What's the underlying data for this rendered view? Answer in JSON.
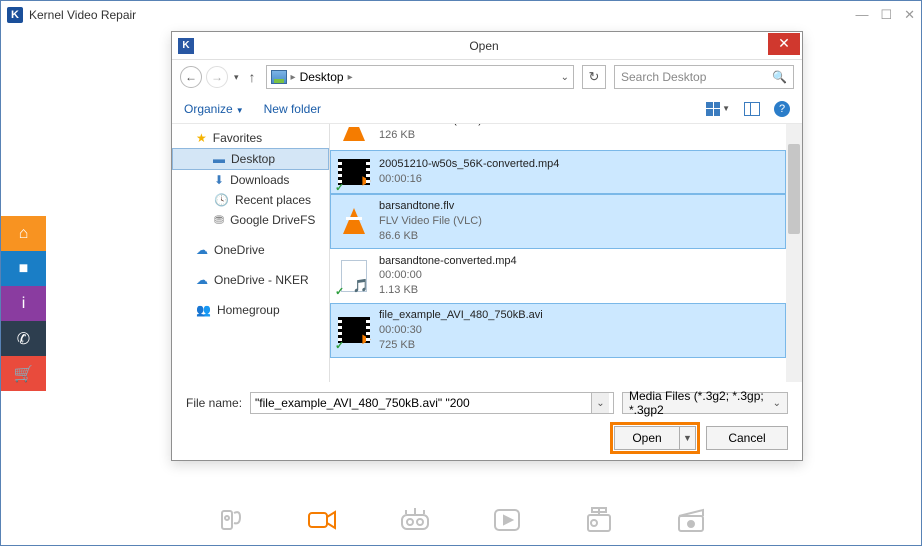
{
  "app": {
    "title": "Kernel Video Repair",
    "icon_letter": "K"
  },
  "dialog": {
    "title": "Open",
    "icon_letter": "K",
    "breadcrumb": {
      "location": "Desktop"
    },
    "search_placeholder": "Search Desktop",
    "organize_label": "Organize",
    "newfolder_label": "New folder",
    "nav": {
      "favorites": "Favorites",
      "desktop": "Desktop",
      "downloads": "Downloads",
      "recent": "Recent places",
      "gdrive": "Google DriveFS",
      "onedrive": "OneDrive",
      "onedrive_nker": "OneDrive - NKER",
      "homegroup": "Homegroup"
    },
    "files": [
      {
        "name": "FLV Video File (VLC)",
        "meta1": "126 KB",
        "meta2": "",
        "thumb": "vlc",
        "selected": false,
        "partial": true
      },
      {
        "name": "20051210-w50s_56K-converted.mp4",
        "meta1": "00:00:16",
        "meta2": "",
        "thumb": "video",
        "selected": true
      },
      {
        "name": "barsandtone.flv",
        "meta1": "FLV Video File (VLC)",
        "meta2": "86.6 KB",
        "thumb": "vlc",
        "selected": true
      },
      {
        "name": "barsandtone-converted.mp4",
        "meta1": "00:00:00",
        "meta2": "1.13 KB",
        "thumb": "doc",
        "selected": false
      },
      {
        "name": "file_example_AVI_480_750kB.avi",
        "meta1": "00:00:30",
        "meta2": "725 KB",
        "thumb": "video",
        "selected": true
      }
    ],
    "filename_label": "File name:",
    "filename_value": "\"file_example_AVI_480_750kB.avi\" \"200",
    "filter_label": "Media Files (*.3g2; *.3gp; *.3gp2",
    "open_btn": "Open",
    "cancel_btn": "Cancel"
  }
}
